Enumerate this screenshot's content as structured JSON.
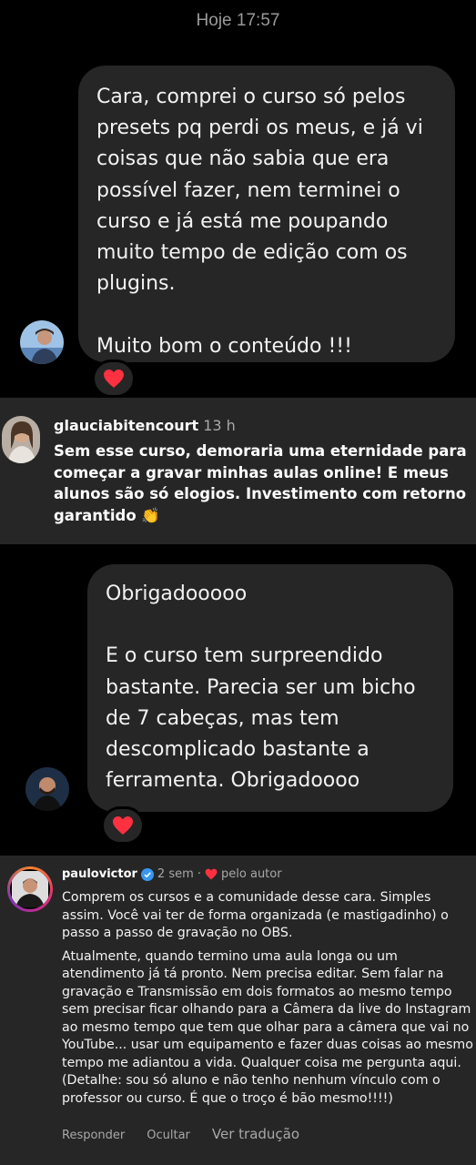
{
  "header": {
    "timestamp": "Hoje 17:57"
  },
  "messages": [
    {
      "text": "Cara, comprei o curso só pelos presets pq perdi os meus, e já vi coisas que não sabia que era possível fazer, nem terminei o curso e já está me poupando muito tempo de edição com os plugins.\n\nMuito bom o conteúdo !!!",
      "reaction": "heart-icon"
    },
    {
      "text": "Obrigadooooo\n\nE o curso tem surpreendido bastante. Parecia ser um bicho de 7 cabeças, mas tem descomplicado bastante a ferramenta. Obrigadoooo",
      "reaction": "heart-icon"
    }
  ],
  "comment1": {
    "username": "glauciabitencourt",
    "time": "13 h",
    "text": "Sem esse curso, demoraria uma eternidade para começar a gravar minhas aulas online! E meus alunos são só elogios. Investimento com retorno garantido 👏"
  },
  "comment2": {
    "username": "paulovictor",
    "time": "2 sem ·",
    "author_label": "pelo autor",
    "paragraph1": "Comprem os cursos e a comunidade desse cara. Simples assim. Você vai ter de forma organizada (e mastigadinho) o passo a passo de gravação no OBS.",
    "paragraph2": "Atualmente, quando termino uma aula longa ou um atendimento já tá pronto. Nem precisa editar. Sem falar na gravação e Transmissão em dois formatos ao mesmo tempo sem precisar ficar olhando para a Câmera da live do Instagram ao mesmo tempo que tem que olhar para a câmera que vai no YouTube... usar um equipamento e fazer duas coisas ao mesmo tempo me adiantou a vida. Qualquer coisa me pergunta aqui. (Detalhe: sou só aluno e não tenho nenhum vínculo com o professor ou curso. É que o troço é bão mesmo!!!!)",
    "actions": {
      "reply": "Responder",
      "hide": "Ocultar",
      "translate": "Ver tradução"
    }
  },
  "colors": {
    "background": "#000000",
    "bubble": "#262626",
    "heart": "#ff3040",
    "verified": "#3897f0"
  }
}
